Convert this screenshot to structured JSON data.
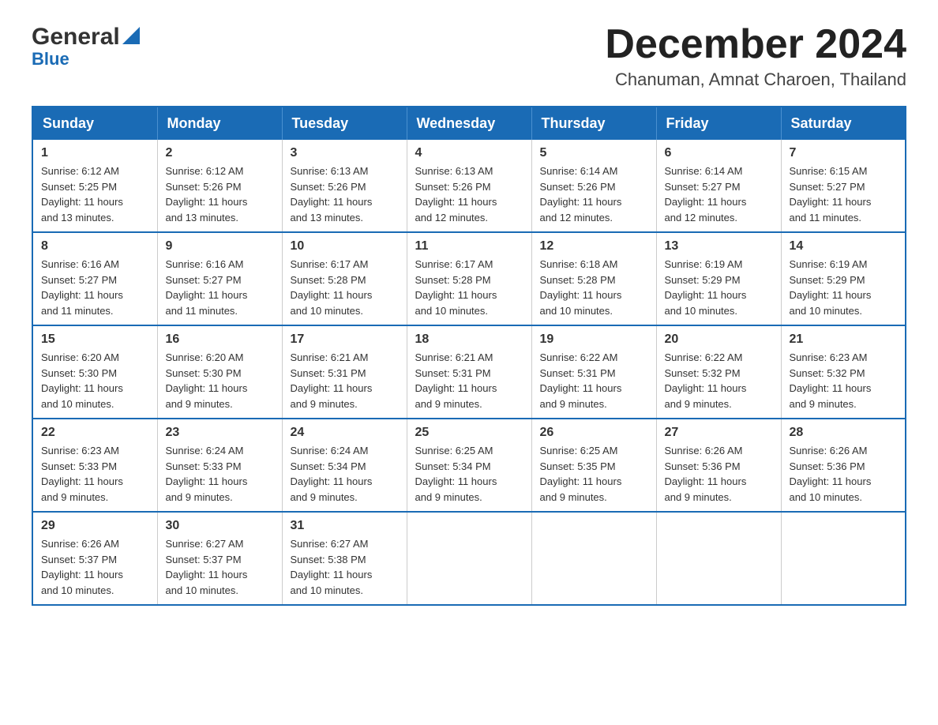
{
  "header": {
    "logo_general": "General",
    "logo_blue": "Blue",
    "month_title": "December 2024",
    "location": "Chanuman, Amnat Charoen, Thailand"
  },
  "days_of_week": [
    "Sunday",
    "Monday",
    "Tuesday",
    "Wednesday",
    "Thursday",
    "Friday",
    "Saturday"
  ],
  "weeks": [
    [
      {
        "day": "1",
        "sunrise": "6:12 AM",
        "sunset": "5:25 PM",
        "daylight": "11 hours and 13 minutes."
      },
      {
        "day": "2",
        "sunrise": "6:12 AM",
        "sunset": "5:26 PM",
        "daylight": "11 hours and 13 minutes."
      },
      {
        "day": "3",
        "sunrise": "6:13 AM",
        "sunset": "5:26 PM",
        "daylight": "11 hours and 13 minutes."
      },
      {
        "day": "4",
        "sunrise": "6:13 AM",
        "sunset": "5:26 PM",
        "daylight": "11 hours and 12 minutes."
      },
      {
        "day": "5",
        "sunrise": "6:14 AM",
        "sunset": "5:26 PM",
        "daylight": "11 hours and 12 minutes."
      },
      {
        "day": "6",
        "sunrise": "6:14 AM",
        "sunset": "5:27 PM",
        "daylight": "11 hours and 12 minutes."
      },
      {
        "day": "7",
        "sunrise": "6:15 AM",
        "sunset": "5:27 PM",
        "daylight": "11 hours and 11 minutes."
      }
    ],
    [
      {
        "day": "8",
        "sunrise": "6:16 AM",
        "sunset": "5:27 PM",
        "daylight": "11 hours and 11 minutes."
      },
      {
        "day": "9",
        "sunrise": "6:16 AM",
        "sunset": "5:27 PM",
        "daylight": "11 hours and 11 minutes."
      },
      {
        "day": "10",
        "sunrise": "6:17 AM",
        "sunset": "5:28 PM",
        "daylight": "11 hours and 10 minutes."
      },
      {
        "day": "11",
        "sunrise": "6:17 AM",
        "sunset": "5:28 PM",
        "daylight": "11 hours and 10 minutes."
      },
      {
        "day": "12",
        "sunrise": "6:18 AM",
        "sunset": "5:28 PM",
        "daylight": "11 hours and 10 minutes."
      },
      {
        "day": "13",
        "sunrise": "6:19 AM",
        "sunset": "5:29 PM",
        "daylight": "11 hours and 10 minutes."
      },
      {
        "day": "14",
        "sunrise": "6:19 AM",
        "sunset": "5:29 PM",
        "daylight": "11 hours and 10 minutes."
      }
    ],
    [
      {
        "day": "15",
        "sunrise": "6:20 AM",
        "sunset": "5:30 PM",
        "daylight": "11 hours and 10 minutes."
      },
      {
        "day": "16",
        "sunrise": "6:20 AM",
        "sunset": "5:30 PM",
        "daylight": "11 hours and 9 minutes."
      },
      {
        "day": "17",
        "sunrise": "6:21 AM",
        "sunset": "5:31 PM",
        "daylight": "11 hours and 9 minutes."
      },
      {
        "day": "18",
        "sunrise": "6:21 AM",
        "sunset": "5:31 PM",
        "daylight": "11 hours and 9 minutes."
      },
      {
        "day": "19",
        "sunrise": "6:22 AM",
        "sunset": "5:31 PM",
        "daylight": "11 hours and 9 minutes."
      },
      {
        "day": "20",
        "sunrise": "6:22 AM",
        "sunset": "5:32 PM",
        "daylight": "11 hours and 9 minutes."
      },
      {
        "day": "21",
        "sunrise": "6:23 AM",
        "sunset": "5:32 PM",
        "daylight": "11 hours and 9 minutes."
      }
    ],
    [
      {
        "day": "22",
        "sunrise": "6:23 AM",
        "sunset": "5:33 PM",
        "daylight": "11 hours and 9 minutes."
      },
      {
        "day": "23",
        "sunrise": "6:24 AM",
        "sunset": "5:33 PM",
        "daylight": "11 hours and 9 minutes."
      },
      {
        "day": "24",
        "sunrise": "6:24 AM",
        "sunset": "5:34 PM",
        "daylight": "11 hours and 9 minutes."
      },
      {
        "day": "25",
        "sunrise": "6:25 AM",
        "sunset": "5:34 PM",
        "daylight": "11 hours and 9 minutes."
      },
      {
        "day": "26",
        "sunrise": "6:25 AM",
        "sunset": "5:35 PM",
        "daylight": "11 hours and 9 minutes."
      },
      {
        "day": "27",
        "sunrise": "6:26 AM",
        "sunset": "5:36 PM",
        "daylight": "11 hours and 9 minutes."
      },
      {
        "day": "28",
        "sunrise": "6:26 AM",
        "sunset": "5:36 PM",
        "daylight": "11 hours and 10 minutes."
      }
    ],
    [
      {
        "day": "29",
        "sunrise": "6:26 AM",
        "sunset": "5:37 PM",
        "daylight": "11 hours and 10 minutes."
      },
      {
        "day": "30",
        "sunrise": "6:27 AM",
        "sunset": "5:37 PM",
        "daylight": "11 hours and 10 minutes."
      },
      {
        "day": "31",
        "sunrise": "6:27 AM",
        "sunset": "5:38 PM",
        "daylight": "11 hours and 10 minutes."
      },
      null,
      null,
      null,
      null
    ]
  ],
  "labels": {
    "sunrise": "Sunrise:",
    "sunset": "Sunset:",
    "daylight": "Daylight:"
  }
}
